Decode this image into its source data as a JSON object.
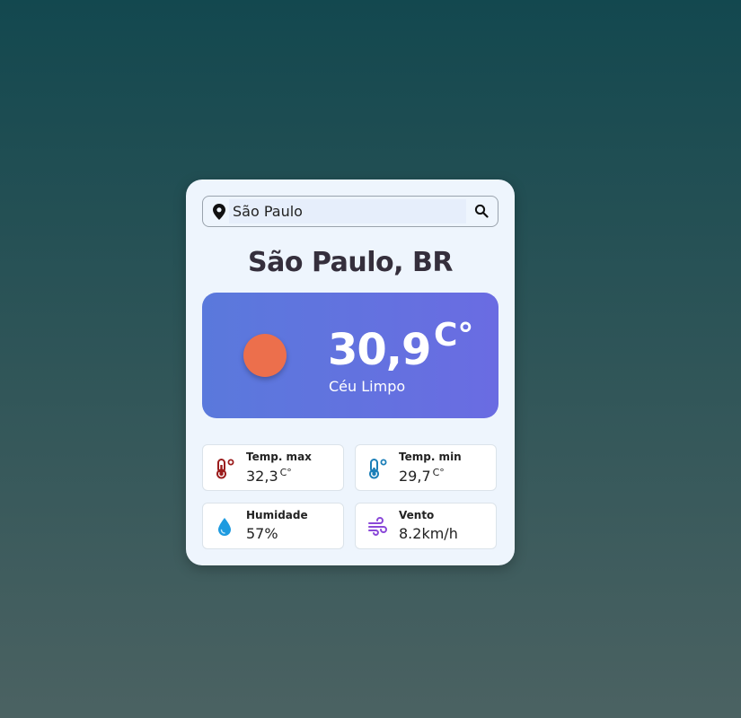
{
  "search": {
    "value": "São Paulo",
    "pin_icon": "map-pin-icon",
    "search_icon": "search-icon"
  },
  "weather": {
    "city": "São Paulo, BR",
    "temperature": "30,9",
    "unit": "C°",
    "description": "Céu Limpo",
    "condition_icon": "sun-icon",
    "panel_colors": [
      "#5a79dc",
      "#6a6ce2"
    ],
    "sun_color": "#ec6f4c"
  },
  "details": {
    "temp_max": {
      "label": "Temp. max",
      "value": "32,3",
      "unit": "C°",
      "icon": "thermometer-hot-icon",
      "color": "#9b1c1c"
    },
    "temp_min": {
      "label": "Temp. min",
      "value": "29,7",
      "unit": "C°",
      "icon": "thermometer-cold-icon",
      "color": "#1c7fb8"
    },
    "humidity": {
      "label": "Humidade",
      "value": "57%",
      "icon": "water-drop-icon",
      "color": "#1e9be0"
    },
    "wind": {
      "label": "Vento",
      "value": "8.2km/h",
      "icon": "wind-icon",
      "color": "#8a48d8"
    }
  }
}
